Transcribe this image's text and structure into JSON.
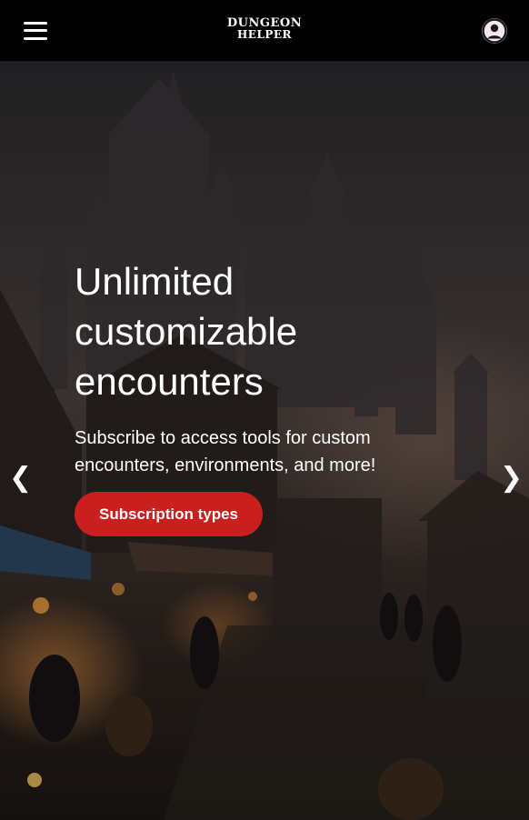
{
  "header": {
    "logo_line1": "DUNGEON",
    "logo_line2": "HELPER"
  },
  "hero": {
    "title": "Unlimited customizable encounters",
    "subtitle": "Subscribe to access tools for custom encounters, environments, and more!",
    "cta_label": "Subscription types",
    "prev_arrow": "❮",
    "next_arrow": "❯"
  },
  "colors": {
    "header_bg": "#000000",
    "cta_bg": "#c9201f",
    "account_icon_bg": "#f5e6f2"
  },
  "icons": [
    "hamburger-menu-icon",
    "account-circle-icon",
    "chevron-left-icon",
    "chevron-right-icon"
  ]
}
